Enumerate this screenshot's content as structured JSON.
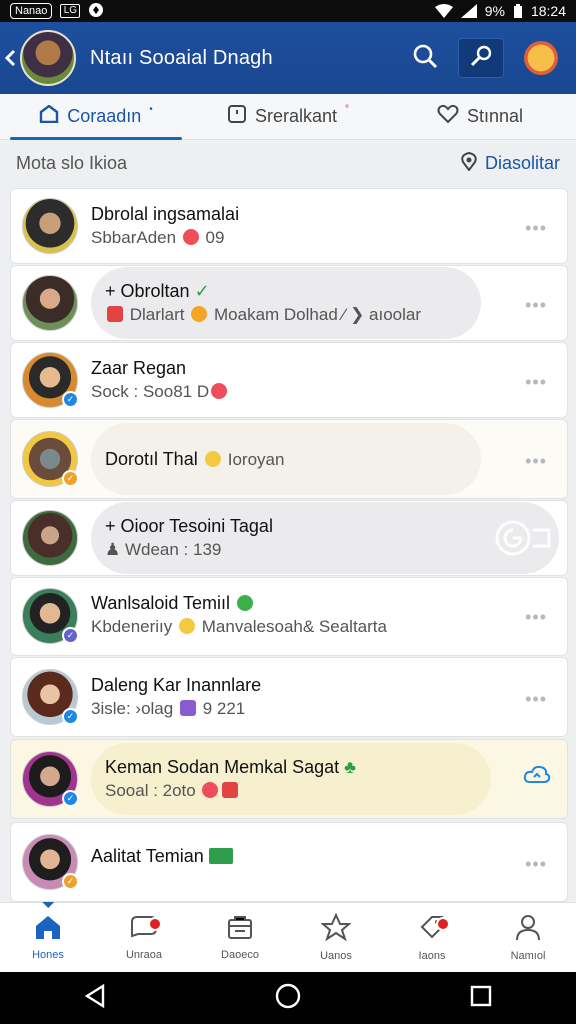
{
  "status_bar": {
    "left_label": "Nanao",
    "left_box": "LG",
    "battery": "9%",
    "time": "18:24"
  },
  "header": {
    "title": "Ntaıı Sooaial Dnagh"
  },
  "tabs": [
    {
      "label": "Coraadın",
      "mark": "•"
    },
    {
      "label": "Sreralkant",
      "mark": "°"
    },
    {
      "label": "Stınnal",
      "mark": ""
    }
  ],
  "section": {
    "title": "Mota slo Ikioa",
    "action": "Diasolitar"
  },
  "rows": [
    {
      "name": "Dbrolal ingsamalai",
      "sub": "SbbarAden",
      "sub_extra": "09",
      "badge": ""
    },
    {
      "name": "Obroltan",
      "sub": "Dlarlart",
      "sub_extra": "Moakam Dolhad ⁄ ❯ aıoolar",
      "badge": ""
    },
    {
      "name": "Zaar Regan",
      "sub": "Sock : Soo81 D",
      "sub_extra": "",
      "badge": "✓"
    },
    {
      "name": "Dorotıl Thal",
      "sub": "",
      "sub_extra": "Ioroyan",
      "badge": "✓"
    },
    {
      "name": "Oioor Tesoini Tagal",
      "sub": "Wdean : 139",
      "sub_extra": "",
      "badge": ""
    },
    {
      "name": "Wanlsaloid Temiıl",
      "sub": "Kbdeneriıy",
      "sub_extra": "Manvalesoah& Sealtarta",
      "badge": "✓"
    },
    {
      "name": "Daleng Kar Inannlare",
      "sub": "3isle: ›olag",
      "sub_extra": "9 221",
      "badge": "✓"
    },
    {
      "name": "Keman Sodan Memkal Sagat",
      "sub": "Sooal : 2oto",
      "sub_extra": "",
      "badge": "✓"
    },
    {
      "name": "Aalitat Temian",
      "sub": "",
      "sub_extra": "",
      "badge": "✓"
    }
  ],
  "more_label": "•••",
  "bottom_nav": [
    {
      "label": "Hones"
    },
    {
      "label": "Unraoa"
    },
    {
      "label": "Daoeco"
    },
    {
      "label": "Uanos"
    },
    {
      "label": "Iaons"
    },
    {
      "label": "Namıol"
    }
  ]
}
